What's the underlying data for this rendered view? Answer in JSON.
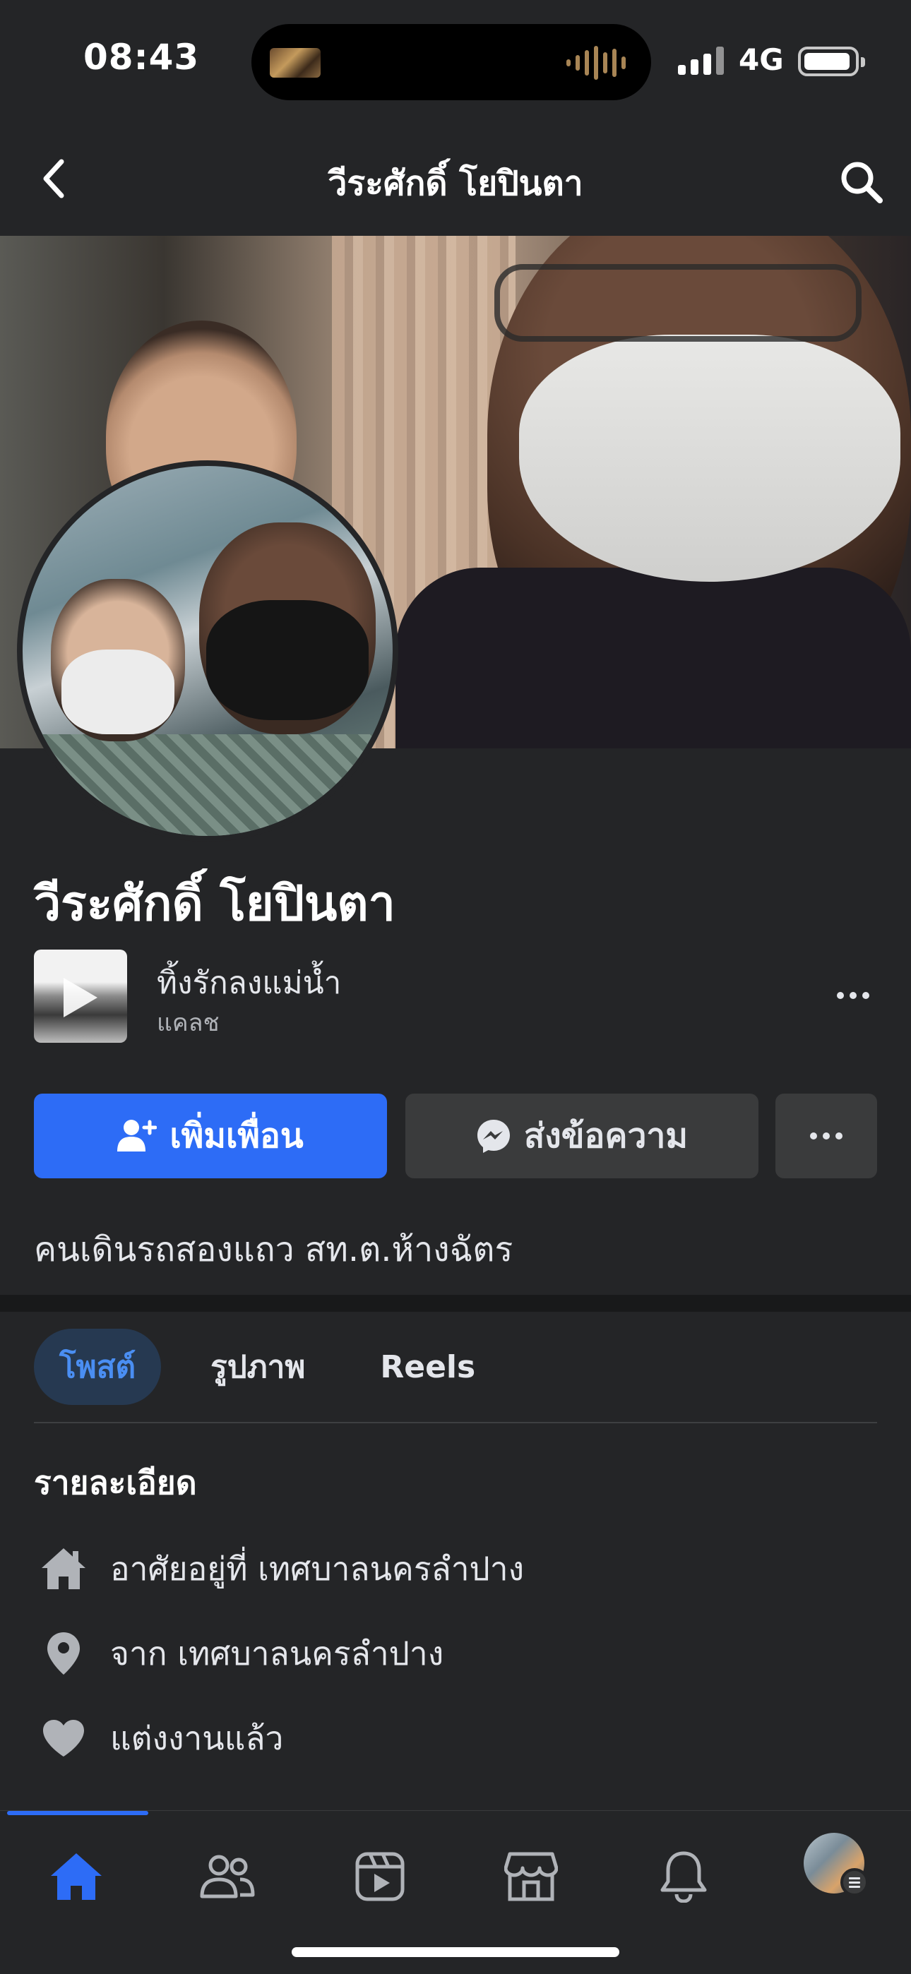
{
  "status_bar": {
    "time": "08:43",
    "network": "4G"
  },
  "header": {
    "title": "วีระศักดิ์ โยปินตา"
  },
  "profile": {
    "name": "วีระศักดิ์ โยปินตา",
    "music": {
      "title": "ทิ้งรักลงแม่น้ำ",
      "artist": "แคลช"
    },
    "bio": "คนเดินรถสองแถว สท.ต.ห้างฉัตร"
  },
  "actions": {
    "add_friend": "เพิ่มเพื่อน",
    "message": "ส่งข้อความ"
  },
  "tabs": [
    {
      "label": "โพสต์",
      "active": true
    },
    {
      "label": "รูปภาพ",
      "active": false
    },
    {
      "label": "Reels",
      "active": false
    }
  ],
  "details": {
    "heading": "รายละเอียด",
    "items": [
      {
        "icon": "home-icon",
        "text": "อาศัยอยู่ที่ เทศบาลนครลำปาง"
      },
      {
        "icon": "location-pin-icon",
        "text": "จาก เทศบาลนครลำปาง"
      },
      {
        "icon": "heart-icon",
        "text": "แต่งงานแล้ว"
      }
    ]
  },
  "bottom_nav": [
    "home-icon",
    "friends-icon",
    "video-icon",
    "marketplace-icon",
    "notifications-icon",
    "profile-menu-avatar"
  ],
  "colors": {
    "accent": "#2d6cf6",
    "background": "#242527",
    "active_tab_bg": "#263951",
    "active_tab_text": "#4a8ef2"
  }
}
